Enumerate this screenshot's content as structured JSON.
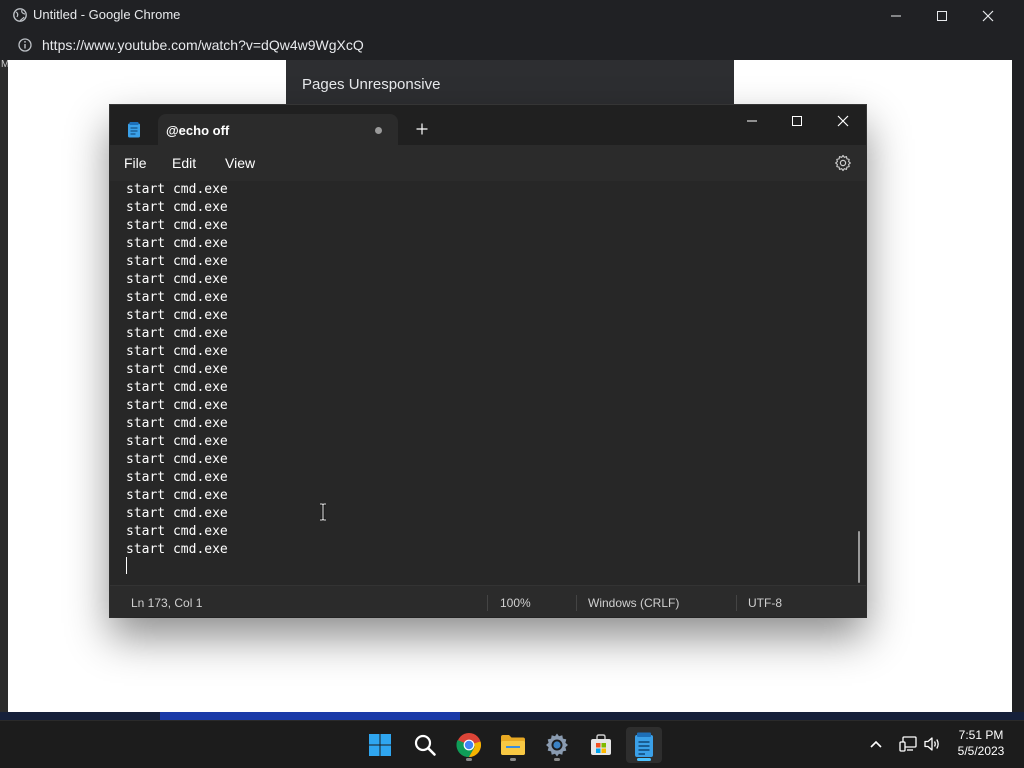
{
  "chrome": {
    "window_title": "Untitled - Google Chrome",
    "url": "https://www.youtube.com/watch?v=dQw4w9WgXcQ",
    "left_edge_text": "M",
    "dialog_title": "Pages Unresponsive"
  },
  "notepad": {
    "tab_title": "@echo off",
    "tab_unsaved": true,
    "menu": [
      "File",
      "Edit",
      "View"
    ],
    "lines": [
      "start cmd.exe",
      "start cmd.exe",
      "start cmd.exe",
      "start cmd.exe",
      "start cmd.exe",
      "start cmd.exe",
      "start cmd.exe",
      "start cmd.exe",
      "start cmd.exe",
      "start cmd.exe",
      "start cmd.exe",
      "start cmd.exe",
      "start cmd.exe",
      "start cmd.exe",
      "start cmd.exe",
      "start cmd.exe",
      "start cmd.exe",
      "start cmd.exe",
      "start cmd.exe",
      "start cmd.exe",
      "start cmd.exe"
    ],
    "status": {
      "position": "Ln 173, Col 1",
      "zoom": "100%",
      "line_ending": "Windows (CRLF)",
      "encoding": "UTF-8"
    }
  },
  "taskbar": {
    "apps": [
      "start-icon",
      "search-icon",
      "chrome-icon",
      "file-explorer-icon",
      "settings-icon",
      "microsoft-store-icon",
      "notepad-icon"
    ],
    "active_app": "notepad-icon",
    "time": "7:51 PM",
    "date": "5/5/2023"
  },
  "colors": {
    "accent": "#4cc2ff",
    "notepad_editor_bg": "#272727",
    "chrome_frame": "#202124"
  }
}
